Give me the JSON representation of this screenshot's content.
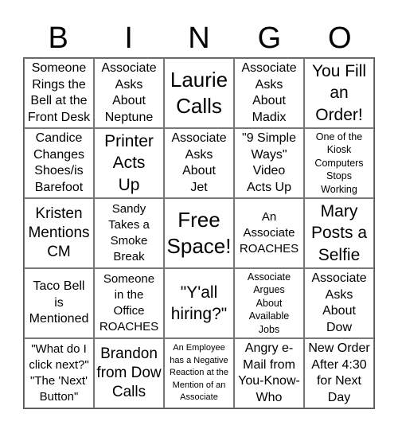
{
  "header": {
    "letters": [
      "B",
      "I",
      "N",
      "G",
      "O"
    ]
  },
  "cells": [
    [
      "Someone\nRings the\nBell at the\nFront Desk",
      "Associate\nAsks\nAbout\nNeptune",
      "Laurie\nCalls",
      "Associate\nAsks\nAbout\nMadix",
      "You Fill\nan\nOrder!"
    ],
    [
      "Candice\nChanges\nShoes/is\nBarefoot",
      "Printer\nActs\nUp",
      "Associate\nAsks\nAbout\nJet",
      "\"9 Simple\nWays\"\nVideo\nActs Up",
      "One of the\nKiosk\nComputers\nStops\nWorking"
    ],
    [
      "Kristen\nMentions\nCM",
      "Sandy\nTakes a\nSmoke\nBreak",
      "Free\nSpace!",
      "An\nAssociate\nROACHES",
      "Mary\nPosts a\nSelfie"
    ],
    [
      "Taco Bell\nis\nMentioned",
      "Someone\nin the\nOffice\nROACHES",
      "\"Y'all\nhiring?\"",
      "Associate\nArgues\nAbout\nAvailable\nJobs",
      "Associate\nAsks\nAbout\nDow"
    ],
    [
      "\"What do I\nclick next?\"\n\"The 'Next'\nButton\"",
      "Brandon\nfrom Dow\nCalls",
      "An Employee\nhas a Negative\nReaction at the\nMention of an\nAssociate",
      "Angry e-\nMail from\nYou-Know-\nWho",
      "New Order\nAfter 4:30\nfor Next\nDay"
    ]
  ]
}
